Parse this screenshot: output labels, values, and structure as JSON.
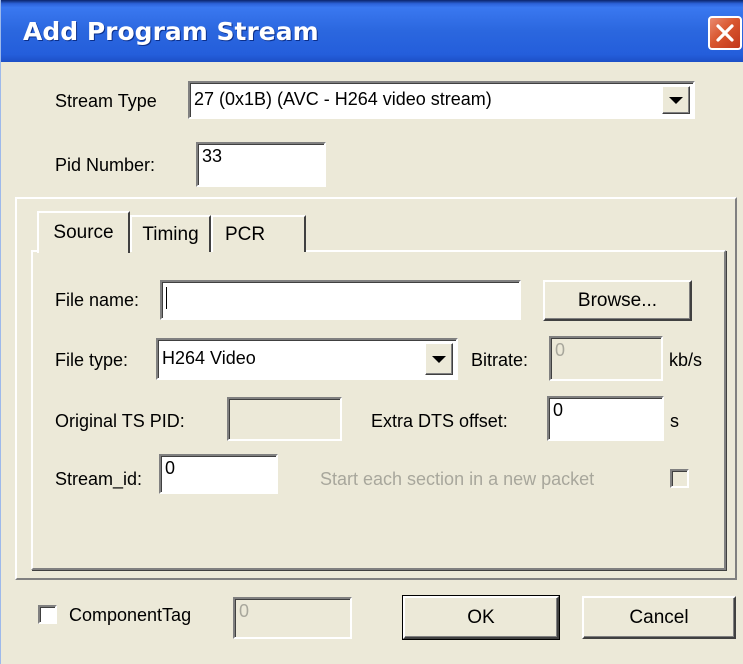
{
  "window": {
    "title": "Add Program Stream",
    "close_icon": "close-icon"
  },
  "stream_type": {
    "label": "Stream Type",
    "value": "27 (0x1B) (AVC - H264 video stream)"
  },
  "pid_number": {
    "label": "Pid Number:",
    "value": "33"
  },
  "tabs": [
    {
      "label": "Source",
      "active": true
    },
    {
      "label": "Timing",
      "active": false
    },
    {
      "label": "PCR",
      "active": false
    }
  ],
  "source": {
    "file_name_label": "File name:",
    "file_name_value": "",
    "browse_label": "Browse...",
    "file_type_label": "File type:",
    "file_type_value": "H264 Video",
    "bitrate_label": "Bitrate:",
    "bitrate_value": "0",
    "bitrate_unit": "kb/s",
    "original_ts_pid_label": "Original TS PID:",
    "original_ts_pid_value": "",
    "extra_dts_label": "Extra DTS offset:",
    "extra_dts_value": "0",
    "extra_dts_unit": "s",
    "stream_id_label": "Stream_id:",
    "stream_id_value": "0",
    "new_packet_label": "Start each section in a new packet",
    "new_packet_checked": false
  },
  "footer": {
    "component_tag_label": "ComponentTag",
    "component_tag_checked": false,
    "component_tag_value": "0",
    "ok_label": "OK",
    "cancel_label": "Cancel"
  },
  "colors": {
    "titlebar": "#245edb",
    "dialog_bg": "#ece9d8",
    "close_button": "#d9572f",
    "disabled_text": "#a8a79c"
  }
}
